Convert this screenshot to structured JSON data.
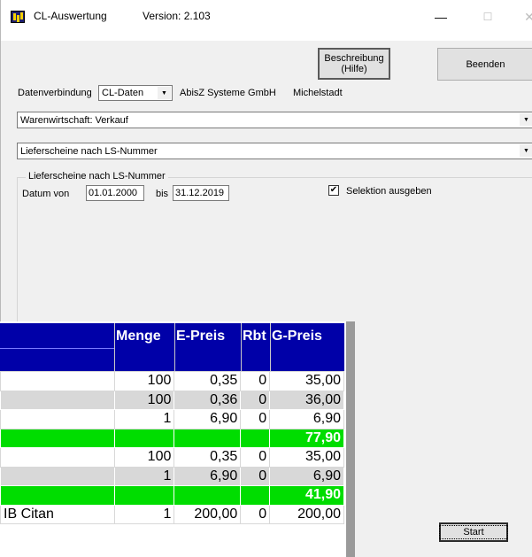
{
  "window": {
    "title": "CL-Auswertung",
    "version": "Version: 2.103",
    "min_glyph": "—",
    "max_glyph": "☐",
    "close_glyph": "✕"
  },
  "buttons": {
    "description_line1": "Beschreibung",
    "description_line2": "(Hilfe)",
    "end": "Beenden",
    "start": "Start"
  },
  "connection": {
    "label": "Datenverbindung",
    "selected": "CL-Daten",
    "company": "AbisZ Systeme GmbH",
    "city": "Michelstadt"
  },
  "area_select": {
    "selected": "Warenwirtschaft: Verkauf"
  },
  "report_select": {
    "selected": "Lieferscheine nach LS-Nummer"
  },
  "group": {
    "title": "Lieferscheine nach LS-Nummer",
    "date_from_label": "Datum von",
    "date_from": "01.01.2000",
    "date_to_label": "bis",
    "date_to": "31.12.2019",
    "checkbox_label": "Selektion ausgeben",
    "checkbox_checked": true
  },
  "report": {
    "headers": [
      "Menge",
      "E-Preis",
      "Rbt",
      "G-Preis"
    ],
    "rows": [
      {
        "type": "white",
        "text": "",
        "menge": "100",
        "epreis": "0,35",
        "rbt": "0",
        "gpreis": "35,00"
      },
      {
        "type": "gray",
        "text": "",
        "menge": "100",
        "epreis": "0,36",
        "rbt": "0",
        "gpreis": "36,00"
      },
      {
        "type": "white",
        "text": "",
        "menge": "1",
        "epreis": "6,90",
        "rbt": "0",
        "gpreis": "6,90"
      },
      {
        "type": "green",
        "text": "",
        "menge": "",
        "epreis": "",
        "rbt": "",
        "gpreis": "77,90"
      },
      {
        "type": "white",
        "text": "",
        "menge": "100",
        "epreis": "0,35",
        "rbt": "0",
        "gpreis": "35,00"
      },
      {
        "type": "gray",
        "text": "",
        "menge": "1",
        "epreis": "6,90",
        "rbt": "0",
        "gpreis": "6,90"
      },
      {
        "type": "green",
        "text": "",
        "menge": "",
        "epreis": "",
        "rbt": "",
        "gpreis": "41,90"
      },
      {
        "type": "white",
        "text": "IB Citan",
        "menge": "1",
        "epreis": "200,00",
        "rbt": "0",
        "gpreis": "200,00"
      }
    ]
  },
  "colors": {
    "header_bg": "#0000a8",
    "sum_row_bg": "#00dd00",
    "alt_row_bg": "#d8d8d8"
  }
}
